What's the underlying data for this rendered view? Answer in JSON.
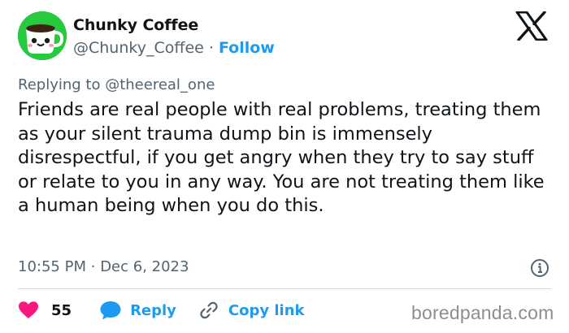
{
  "author": {
    "display_name": "Chunky Coffee",
    "handle": "@Chunky_Coffee",
    "separator": "·",
    "follow_label": "Follow"
  },
  "reply_context": {
    "prefix": "Replying to ",
    "target": "@theereal_one"
  },
  "tweet": {
    "text": "Friends are real people with real problems, treating them as your silent trauma dump bin is immensely disrespectful, if you get angry when they try to say stuff or relate to you in any way. You are not treating them like a human being when you do this."
  },
  "meta": {
    "time": "10:55 PM",
    "separator": "·",
    "date": "Dec 6, 2023"
  },
  "actions": {
    "like_count": "55",
    "reply_label": "Reply",
    "copy_link_label": "Copy link"
  },
  "watermark": "boredpanda.com",
  "icons": {
    "avatar": "coffee-cup-face-avatar",
    "platform": "x-logo-icon",
    "info": "info-circle-icon",
    "like": "heart-icon",
    "reply": "speech-bubble-icon",
    "copy": "link-icon"
  },
  "colors": {
    "accent": "#1d9bf0",
    "like": "#f91880",
    "secondary_text": "#536471",
    "avatar_bg": "#27c93f"
  }
}
